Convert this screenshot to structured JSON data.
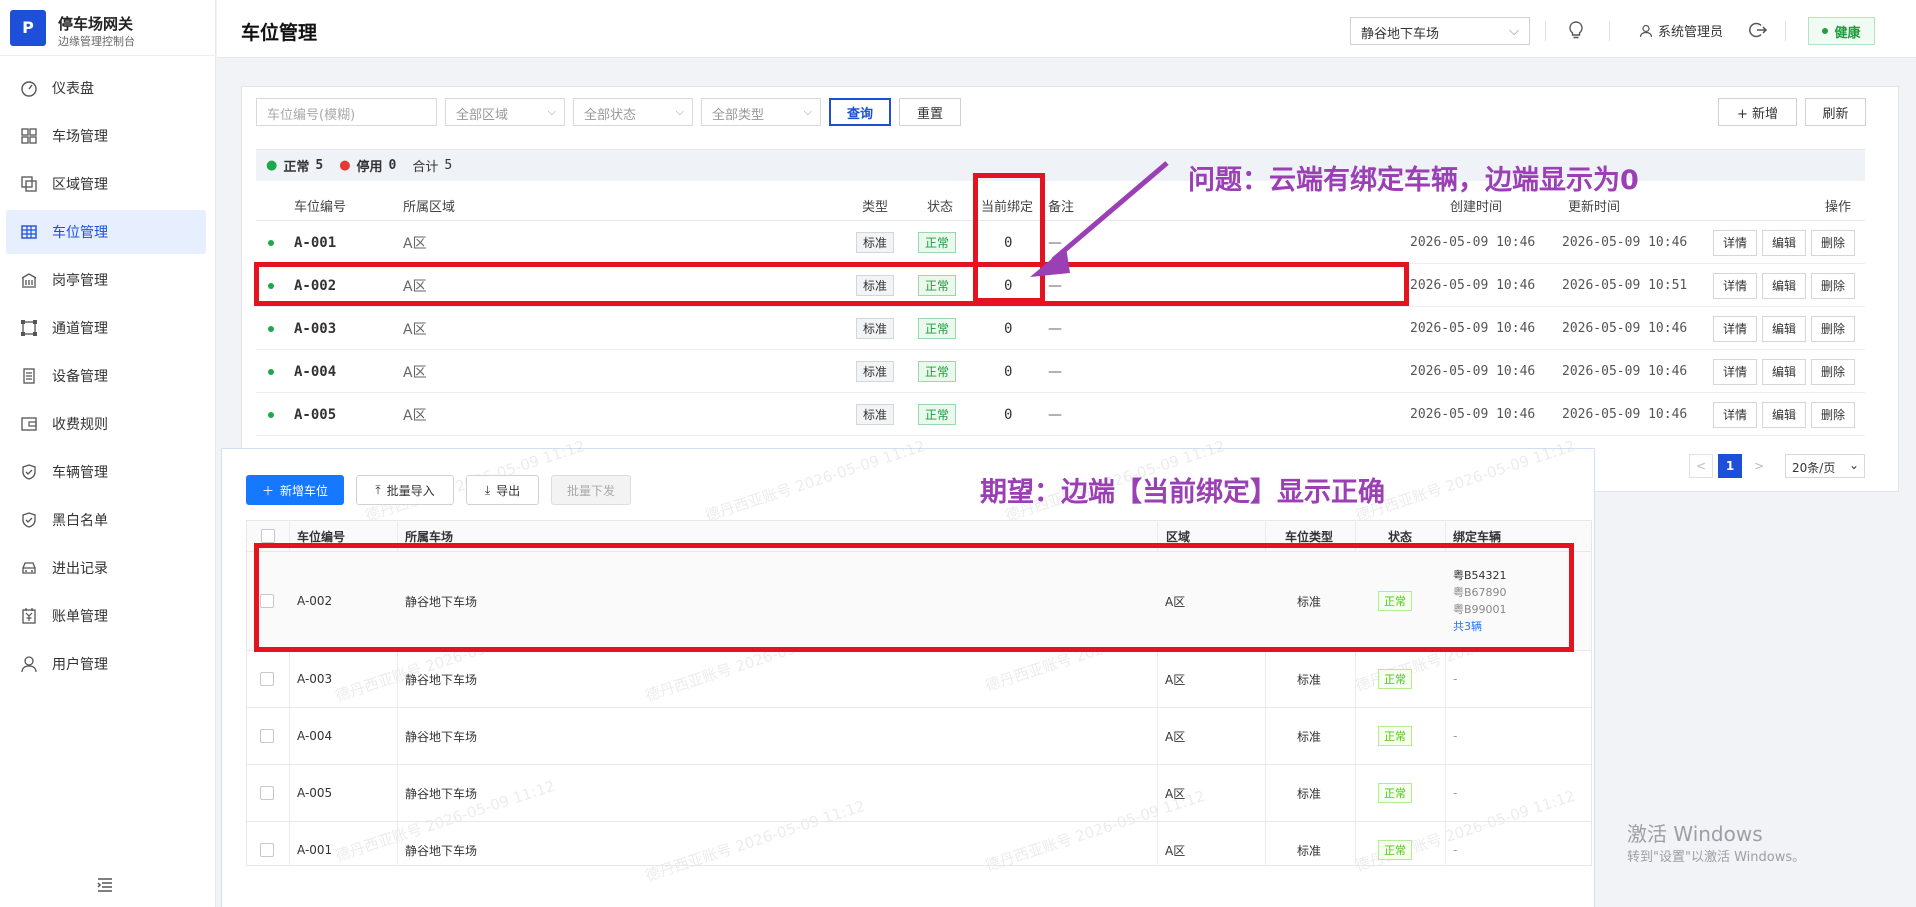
{
  "brand": {
    "logo": "P",
    "title": "停车场网关",
    "subtitle": "边缘管理控制台"
  },
  "nav": [
    {
      "label": "仪表盘",
      "icon": "dashboard-icon"
    },
    {
      "label": "车场管理",
      "icon": "grid-icon"
    },
    {
      "label": "区域管理",
      "icon": "area-icon"
    },
    {
      "label": "车位管理",
      "icon": "table-icon",
      "active": true
    },
    {
      "label": "岗亭管理",
      "icon": "booth-icon"
    },
    {
      "label": "通道管理",
      "icon": "channel-icon"
    },
    {
      "label": "设备管理",
      "icon": "device-icon"
    },
    {
      "label": "收费规则",
      "icon": "wallet-icon"
    },
    {
      "label": "车辆管理",
      "icon": "shield-icon"
    },
    {
      "label": "黑白名单",
      "icon": "shield-check-icon"
    },
    {
      "label": "进出记录",
      "icon": "car-icon"
    },
    {
      "label": "账单管理",
      "icon": "bill-icon"
    },
    {
      "label": "用户管理",
      "icon": "user-icon"
    }
  ],
  "header": {
    "title": "车位管理",
    "lot": "静谷地下车场",
    "admin": "系统管理员",
    "health": "健康"
  },
  "filters": {
    "keyword_placeholder": "车位编号(模糊)",
    "area": "全部区域",
    "status": "全部状态",
    "type": "全部类型",
    "query": "查询",
    "reset": "重置",
    "add": "+ 新增",
    "refresh": "刷新"
  },
  "summary": {
    "normal_label": "正常",
    "normal_count": "5",
    "disabled_label": "停用",
    "disabled_count": "0",
    "total_label": "合计",
    "total_count": "5"
  },
  "columns": {
    "code": "车位编号",
    "area": "所属区域",
    "type": "类型",
    "status": "状态",
    "bound": "当前绑定",
    "remark": "备注",
    "created": "创建时间",
    "updated": "更新时间",
    "ops": "操作"
  },
  "rows": [
    {
      "code": "A-001",
      "area": "A区",
      "type": "标准",
      "status": "正常",
      "bound": "0",
      "remark": "—",
      "created": "2026-05-09 10:46",
      "updated": "2026-05-09 10:46"
    },
    {
      "code": "A-002",
      "area": "A区",
      "type": "标准",
      "status": "正常",
      "bound": "0",
      "remark": "—",
      "created": "2026-05-09 10:46",
      "updated": "2026-05-09 10:51"
    },
    {
      "code": "A-003",
      "area": "A区",
      "type": "标准",
      "status": "正常",
      "bound": "0",
      "remark": "—",
      "created": "2026-05-09 10:46",
      "updated": "2026-05-09 10:46"
    },
    {
      "code": "A-004",
      "area": "A区",
      "type": "标准",
      "status": "正常",
      "bound": "0",
      "remark": "—",
      "created": "2026-05-09 10:46",
      "updated": "2026-05-09 10:46"
    },
    {
      "code": "A-005",
      "area": "A区",
      "type": "标准",
      "status": "正常",
      "bound": "0",
      "remark": "—",
      "created": "2026-05-09 10:46",
      "updated": "2026-05-09 10:46"
    }
  ],
  "actions": {
    "detail": "详情",
    "edit": "编辑",
    "delete": "删除"
  },
  "pagination": {
    "prev": "<",
    "page": "1",
    "next": ">",
    "size": "20条/页"
  },
  "annotations": {
    "problem": "问题：云端有绑定车辆，边端显示为0",
    "expect": "期望：边端【当前绑定】显示正确"
  },
  "cloud": {
    "buttons": {
      "add": "新增车位",
      "import": "批量导入",
      "export": "导出",
      "dispatch": "批量下发"
    },
    "columns": {
      "code": "车位编号",
      "lot": "所属车场",
      "area": "区域",
      "type": "车位类型",
      "status": "状态",
      "bound": "绑定车辆"
    },
    "rows": [
      {
        "code": "A-002",
        "lot": "静谷地下车场",
        "area": "A区",
        "type": "标准",
        "status": "正常",
        "plates": [
          "粤B54321",
          "粤B67890",
          "粤B99001"
        ],
        "total": "共3辆"
      },
      {
        "code": "A-003",
        "lot": "静谷地下车场",
        "area": "A区",
        "type": "标准",
        "status": "正常",
        "dash": "-"
      },
      {
        "code": "A-004",
        "lot": "静谷地下车场",
        "area": "A区",
        "type": "标准",
        "status": "正常",
        "dash": "-"
      },
      {
        "code": "A-005",
        "lot": "静谷地下车场",
        "area": "A区",
        "type": "标准",
        "status": "正常",
        "dash": "-"
      },
      {
        "code": "A-001",
        "lot": "静谷地下车场",
        "area": "A区",
        "type": "标准",
        "status": "正常",
        "dash": "-"
      }
    ],
    "watermark": "德丹西亚账号 2026-05-09 11:12"
  },
  "windows": {
    "line1": "激活 Windows",
    "line2": "转到\"设置\"以激活 Windows。"
  },
  "colors": {
    "accent": "#1d4fd8",
    "success": "#1ea84a",
    "annotation": "#9b3fb5",
    "highlight": "#e3131f"
  }
}
